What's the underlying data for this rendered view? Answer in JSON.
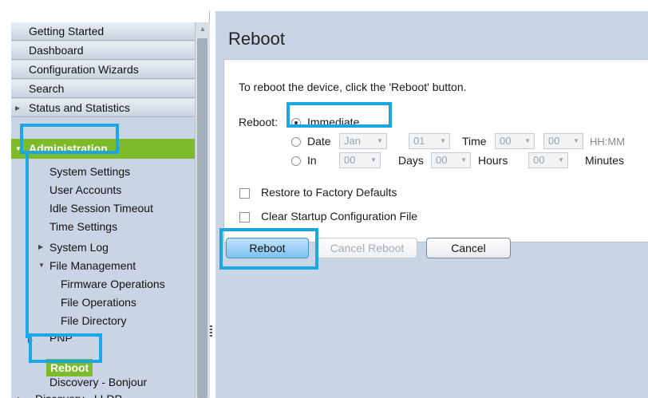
{
  "nav": {
    "top_items": [
      "Getting Started",
      "Dashboard",
      "Configuration Wizards",
      "Search",
      "Status and Statistics"
    ],
    "section": "Administration",
    "sub_items": [
      "System Settings",
      "User Accounts",
      "Idle Session Timeout",
      "Time Settings",
      "System Log",
      "File Management"
    ],
    "file_management_items": [
      "Firmware Operations",
      "File Operations",
      "File Directory"
    ],
    "pnp": "PNP",
    "reboot": "Reboot",
    "discovery_bonjour": "Discovery - Bonjour",
    "discovery_lldp": "Discovery - LLDP"
  },
  "page": {
    "title": "Reboot",
    "instruction": "To reboot the device, click the 'Reboot' button.",
    "reboot_label": "Reboot:",
    "options": {
      "immediate": "Immediate",
      "date": "Date",
      "in": "In"
    },
    "selected_option": "immediate",
    "date_month": "Jan",
    "date_day": "01",
    "time_label": "Time",
    "time_hour": "00",
    "time_minute": "00",
    "time_format": "HH:MM",
    "in_days": "00",
    "days_label": "Days",
    "in_hours": "00",
    "hours_label": "Hours",
    "in_minutes": "00",
    "minutes_label": "Minutes",
    "restore_factory": "Restore to Factory Defaults",
    "clear_startup": "Clear Startup Configuration File"
  },
  "buttons": {
    "reboot": "Reboot",
    "cancel_reboot": "Cancel Reboot",
    "cancel": "Cancel"
  },
  "colors": {
    "nav_active": "#7dbb2b",
    "callout": "#1ca6e3",
    "primary_button": "#7fc2ee"
  }
}
